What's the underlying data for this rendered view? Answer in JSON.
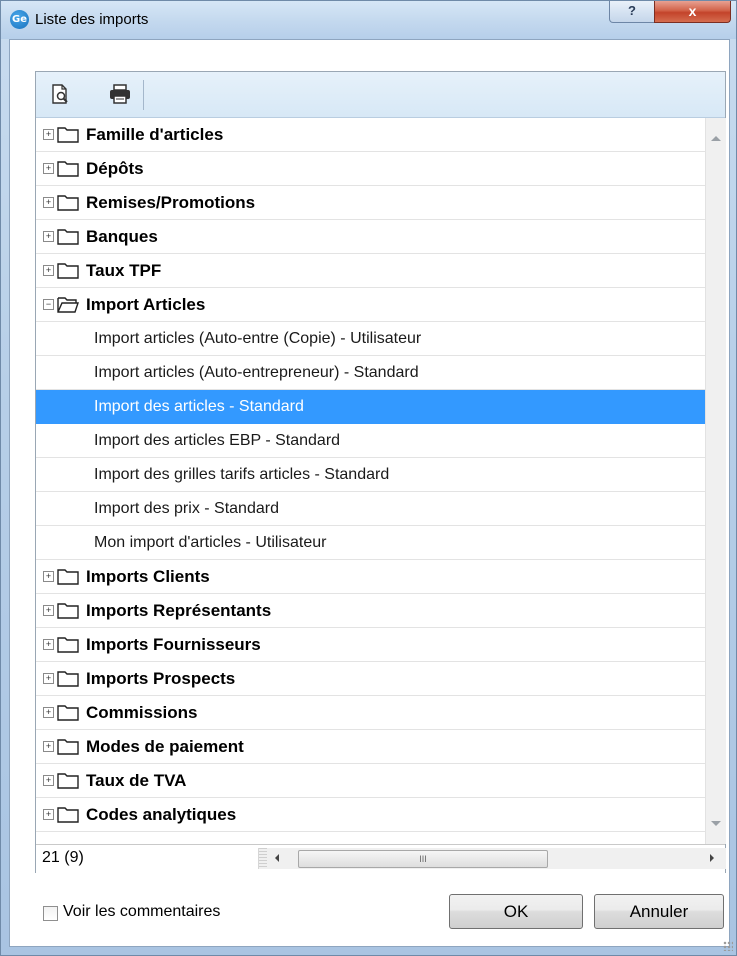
{
  "window": {
    "title": "Liste des imports",
    "app_icon_text": "Ge",
    "help_label": "?",
    "close_label": "x"
  },
  "toolbar": {
    "preview_icon": "print-preview-icon",
    "print_icon": "printer-icon"
  },
  "tree": {
    "groups_before": [
      {
        "label": "Famille d'articles",
        "expander": "+"
      },
      {
        "label": "Dépôts",
        "expander": "+"
      },
      {
        "label": "Remises/Promotions",
        "expander": "+"
      },
      {
        "label": "Banques",
        "expander": "+"
      },
      {
        "label": "Taux TPF",
        "expander": "+"
      }
    ],
    "expanded_group": {
      "label": "Import Articles",
      "expander": "−"
    },
    "items": [
      {
        "label": "Import articles (Auto-entre (Copie) - Utilisateur"
      },
      {
        "label": "Import articles (Auto-entrepreneur) - Standard"
      },
      {
        "label": "Import des articles - Standard"
      },
      {
        "label": "Import des articles EBP - Standard"
      },
      {
        "label": "Import des grilles tarifs articles - Standard"
      },
      {
        "label": "Import des prix - Standard"
      },
      {
        "label": "Mon import d'articles - Utilisateur"
      }
    ],
    "selected_item_index": 2,
    "groups_after": [
      {
        "label": "Imports Clients",
        "expander": "+"
      },
      {
        "label": "Imports Représentants",
        "expander": "+"
      },
      {
        "label": "Imports Fournisseurs",
        "expander": "+"
      },
      {
        "label": "Imports Prospects",
        "expander": "+"
      },
      {
        "label": "Commissions",
        "expander": "+"
      },
      {
        "label": "Modes de paiement",
        "expander": "+"
      },
      {
        "label": "Taux de TVA",
        "expander": "+"
      },
      {
        "label": "Codes analytiques",
        "expander": "+"
      }
    ]
  },
  "status": {
    "count": "21 (9)",
    "scroll_thumb_grip": "III"
  },
  "footer": {
    "show_comments_label": "Voir les commentaires",
    "show_comments_checked": false,
    "ok_label": "OK",
    "cancel_label": "Annuler"
  },
  "colors": {
    "selection": "#3399ff",
    "close_button": "#c3432a",
    "window_frame": "#b7cfe8"
  }
}
